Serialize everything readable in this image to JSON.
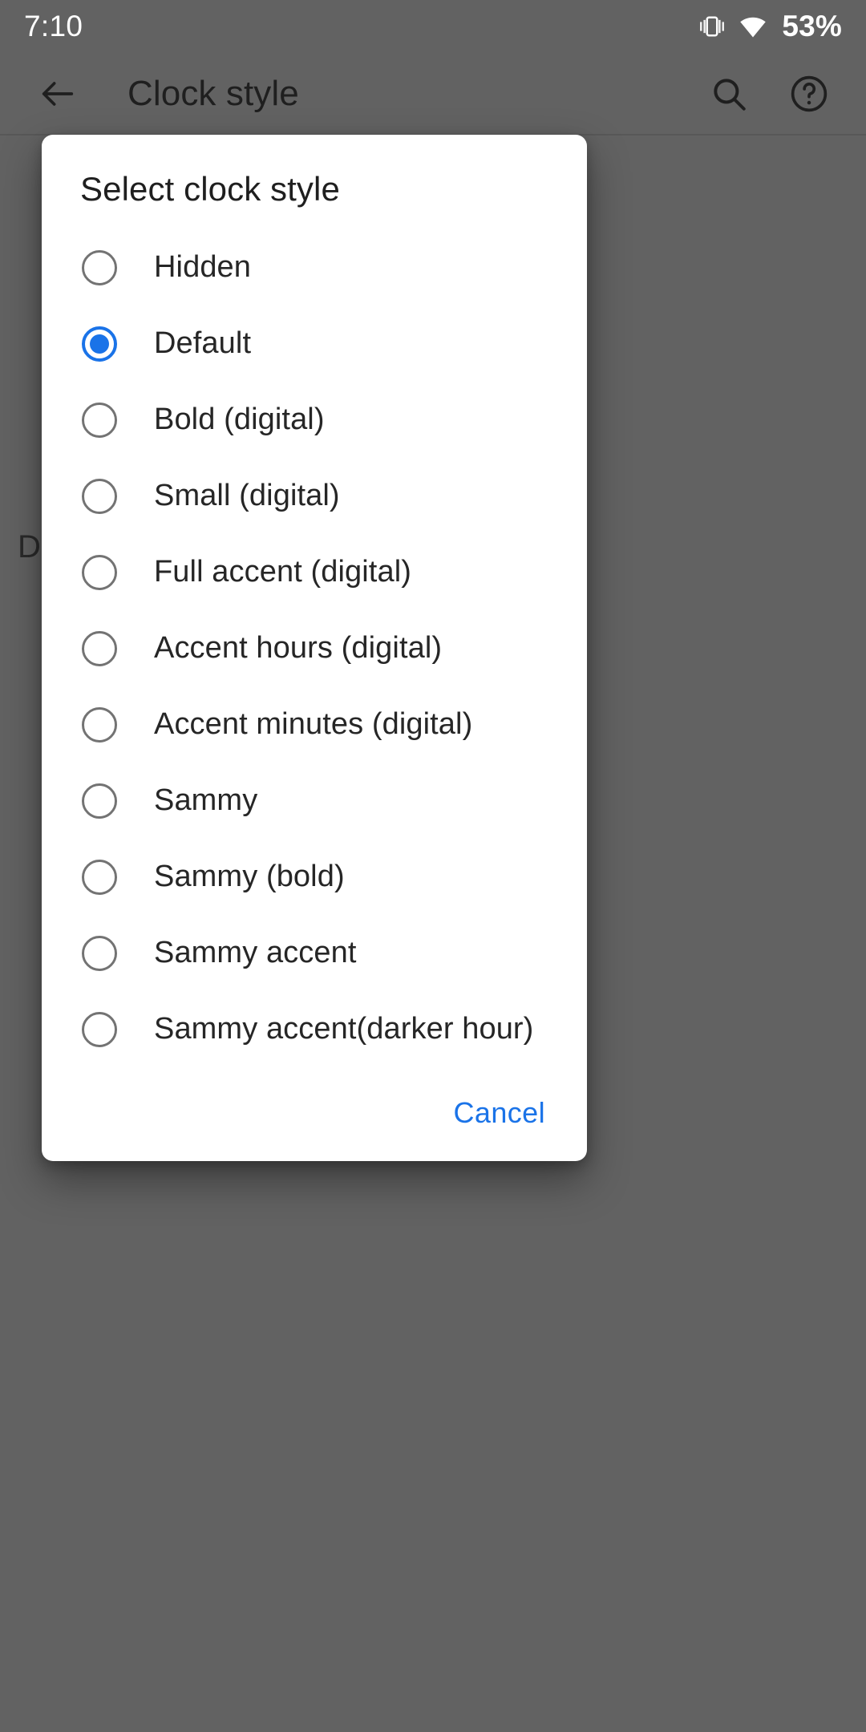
{
  "status_bar": {
    "time": "7:10",
    "battery": "53%",
    "icons": [
      "vibrate-icon",
      "wifi-icon"
    ]
  },
  "app_bar": {
    "back_icon": "back-arrow-icon",
    "title": "Clock style",
    "search_icon": "search-icon",
    "help_icon": "help-circle-icon"
  },
  "background": {
    "ghost_text": "D"
  },
  "dialog": {
    "title": "Select clock style",
    "selected_index": 1,
    "options": [
      {
        "label": "Hidden",
        "selected": false
      },
      {
        "label": "Default",
        "selected": true
      },
      {
        "label": "Bold (digital)",
        "selected": false
      },
      {
        "label": "Small (digital)",
        "selected": false
      },
      {
        "label": "Full accent (digital)",
        "selected": false
      },
      {
        "label": "Accent hours (digital)",
        "selected": false
      },
      {
        "label": "Accent minutes (digital)",
        "selected": false
      },
      {
        "label": "Sammy",
        "selected": false
      },
      {
        "label": "Sammy (bold)",
        "selected": false
      },
      {
        "label": "Sammy accent",
        "selected": false
      },
      {
        "label": "Sammy accent(darker hour)",
        "selected": false
      }
    ],
    "cancel_label": "Cancel"
  },
  "colors": {
    "accent": "#1a73e8",
    "scrim": "#626262",
    "dialog_bg": "#ffffff",
    "text_primary": "#1f1f1f",
    "radio_unchecked": "#737373"
  }
}
